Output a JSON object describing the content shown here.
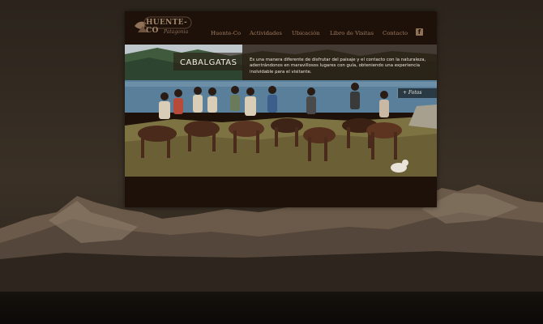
{
  "logo": {
    "name": "HUENTE-CO",
    "tagline": "Patagonia"
  },
  "nav": {
    "items": [
      {
        "label": "Huente-Co"
      },
      {
        "label": "Actividades"
      },
      {
        "label": "Ubicación"
      },
      {
        "label": "Libro de Visitas"
      },
      {
        "label": "Contacto"
      }
    ],
    "facebook_icon": "facebook-icon"
  },
  "hero": {
    "title": "CABALGATAS",
    "description": "Es una manera diferente de disfrutar del paisaje y el contacto con la naturaleza, adentrándonos en maravillosos lugares con guía, obteniendo una experiencia inolvidable para el visitante.",
    "fotos_button": "+ Fotos"
  },
  "colors": {
    "page_bg": "#2a2219",
    "panel_bg": "#1e110a",
    "nav_text": "#a07c5e"
  }
}
